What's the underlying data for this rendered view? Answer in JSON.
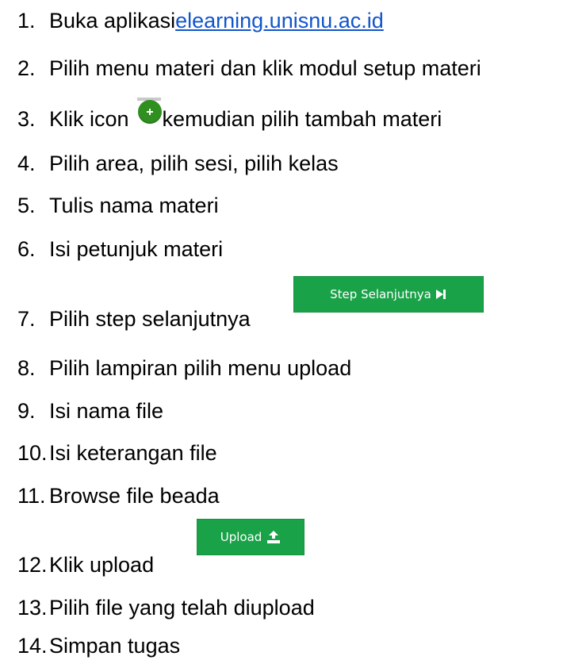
{
  "steps": [
    {
      "num": "1.",
      "text": "Buka aplikasi ",
      "link": "elearning.unisnu.ac.id"
    },
    {
      "num": "2.",
      "text": "Pilih menu materi dan klik modul setup materi"
    },
    {
      "num": "3.",
      "text_before": "Klik icon ",
      "text_after": "kemudian pilih tambah materi",
      "icon": "plus-circle-icon"
    },
    {
      "num": "4.",
      "text": "Pilih area, pilih sesi, pilih kelas"
    },
    {
      "num": "5.",
      "text": "Tulis nama materi"
    },
    {
      "num": "6.",
      "text": "Isi petunjuk materi"
    },
    {
      "num": "7.",
      "text": "Pilih step selanjutnya",
      "button": {
        "label": "Step Selanjutnya",
        "icon": "skip-next-icon",
        "color": "#1aa248"
      }
    },
    {
      "num": "8.",
      "text": "Pilih lampiran pilih menu upload"
    },
    {
      "num": "9.",
      "text": "Isi nama file"
    },
    {
      "num": "10.",
      "text": "Isi keterangan file"
    },
    {
      "num": "11.",
      "text": "Browse file beada"
    },
    {
      "num": "12.",
      "text": "Klik upload",
      "button": {
        "label": "Upload",
        "icon": "upload-icon",
        "color": "#1aa248"
      }
    },
    {
      "num": "13.",
      "text": "Pilih file yang telah diupload"
    },
    {
      "num": "14.",
      "text": "Simpan tugas"
    }
  ],
  "colors": {
    "link": "#1155cc",
    "icon_green": "#2f8f1f",
    "button_green": "#1aa248"
  }
}
